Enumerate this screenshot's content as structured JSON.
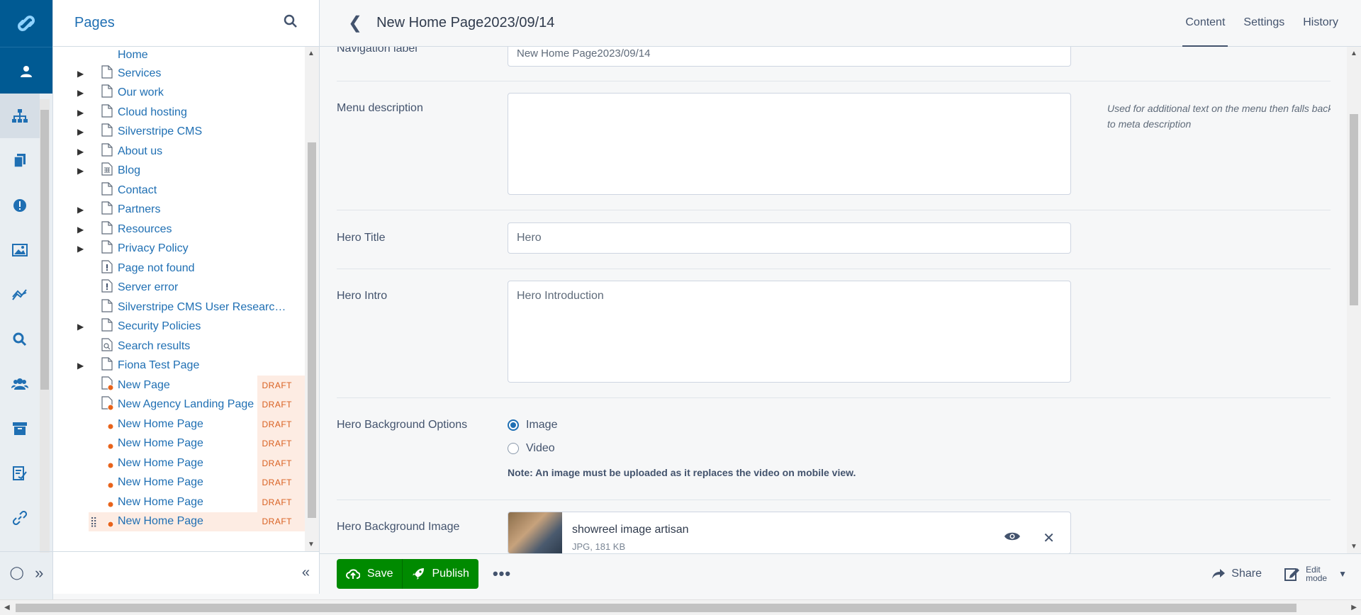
{
  "rail": {
    "icons": [
      "logo-icon",
      "profile-icon",
      "sitetree-icon",
      "pages-icon",
      "reports-icon",
      "files-icon",
      "analytics-icon",
      "search-icon",
      "security-icon",
      "archive-icon",
      "forms-icon",
      "links-icon"
    ],
    "footer": {
      "help_glyph": "◯",
      "expand_glyph": "»"
    }
  },
  "tree": {
    "title": "Pages",
    "collapse_glyph": "«",
    "draft_badge": "DRAFT",
    "items": [
      {
        "label": "Home",
        "toggle": "",
        "icon": "none"
      },
      {
        "label": "Services",
        "toggle": "▶",
        "icon": "page"
      },
      {
        "label": "Our work",
        "toggle": "▶",
        "icon": "page"
      },
      {
        "label": "Cloud hosting",
        "toggle": "▶",
        "icon": "page"
      },
      {
        "label": "Silverstripe CMS",
        "toggle": "▶",
        "icon": "page"
      },
      {
        "label": "About us",
        "toggle": "▶",
        "icon": "page"
      },
      {
        "label": "Blog",
        "toggle": "▶",
        "icon": "blog"
      },
      {
        "label": "Contact",
        "toggle": "",
        "icon": "page"
      },
      {
        "label": "Partners",
        "toggle": "▶",
        "icon": "page"
      },
      {
        "label": "Resources",
        "toggle": "▶",
        "icon": "page"
      },
      {
        "label": "Privacy Policy",
        "toggle": "▶",
        "icon": "page"
      },
      {
        "label": "Page not found",
        "toggle": "",
        "icon": "error"
      },
      {
        "label": "Server error",
        "toggle": "",
        "icon": "error"
      },
      {
        "label": "Silverstripe CMS User Researc…",
        "toggle": "",
        "icon": "page"
      },
      {
        "label": "Security Policies",
        "toggle": "▶",
        "icon": "page"
      },
      {
        "label": "Search results",
        "toggle": "",
        "icon": "search"
      },
      {
        "label": "Fiona Test Page",
        "toggle": "▶",
        "icon": "page"
      },
      {
        "label": "New Page",
        "toggle": "",
        "icon": "draft-page",
        "draft": true
      },
      {
        "label": "New Agency Landing Page",
        "toggle": "",
        "icon": "draft-page",
        "draft": true
      },
      {
        "label": "New Home Page",
        "toggle": "",
        "icon": "draft-dot",
        "draft": true
      },
      {
        "label": "New Home Page",
        "toggle": "",
        "icon": "draft-dot",
        "draft": true
      },
      {
        "label": "New Home Page",
        "toggle": "",
        "icon": "draft-dot",
        "draft": true
      },
      {
        "label": "New Home Page",
        "toggle": "",
        "icon": "draft-dot",
        "draft": true
      },
      {
        "label": "New Home Page",
        "toggle": "",
        "icon": "draft-dot",
        "draft": true
      },
      {
        "label": "New Home Page",
        "toggle": "⣿",
        "icon": "draft-dot",
        "draft": true,
        "selected": true
      }
    ]
  },
  "main": {
    "back_glyph": "❮",
    "title": "New Home Page2023/09/14",
    "tabs": [
      {
        "label": "Content",
        "active": true
      },
      {
        "label": "Settings",
        "active": false
      },
      {
        "label": "History",
        "active": false
      }
    ]
  },
  "form": {
    "nav_label": {
      "label": "Navigation label",
      "value": "New Home Page2023/09/14"
    },
    "menu_desc": {
      "label": "Menu description",
      "value": "",
      "help": "Used for additional text on the menu then falls back to meta description"
    },
    "hero_title": {
      "label": "Hero Title",
      "value": "Hero"
    },
    "hero_intro": {
      "label": "Hero Intro",
      "value": "Hero Introduction"
    },
    "hero_bg_options": {
      "label": "Hero Background Options",
      "options": [
        {
          "label": "Image",
          "checked": true
        },
        {
          "label": "Video",
          "checked": false
        }
      ],
      "note": "Note: An image must be uploaded as it replaces the video on mobile view."
    },
    "hero_bg_image": {
      "label": "Hero Background Image",
      "file_name": "showreel image artisan",
      "file_meta": "JPG, 181 KB",
      "remove_glyph": "✕"
    }
  },
  "actions": {
    "save": "Save",
    "publish": "Publish",
    "more": "•••",
    "share": "Share",
    "edit_mode_line1": "Edit",
    "edit_mode_line2": "mode"
  },
  "colors": {
    "brand": "#005a93",
    "link": "#1f6fb3",
    "publish": "#008a00",
    "draft": "#d96020"
  }
}
